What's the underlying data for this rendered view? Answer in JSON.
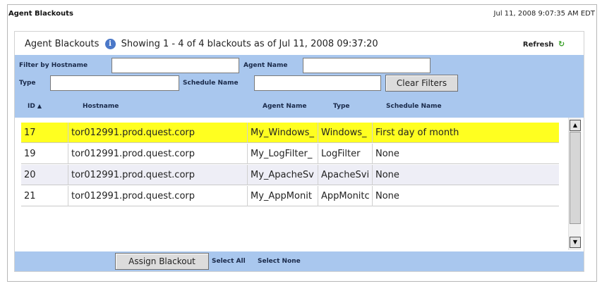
{
  "page": {
    "title": "Agent Blackouts",
    "timestamp": "Jul 11, 2008 9:07:35 AM EDT"
  },
  "panel": {
    "title": "Agent Blackouts",
    "info_icon": "info-icon",
    "summary": "Showing 1 - 4  of 4 blackouts as of Jul 11, 2008 09:37:20",
    "refresh_label": "Refresh",
    "refresh_icon": "refresh-icon"
  },
  "filters": {
    "hostname_label": "Filter by Hostname",
    "hostname_value": "",
    "agent_name_label": "Agent Name",
    "agent_name_value": "",
    "type_label": "Type",
    "type_value": "",
    "schedule_name_label": "Schedule Name",
    "schedule_name_value": "",
    "clear_button": "Clear Filters"
  },
  "table": {
    "columns": [
      "ID",
      "Hostname",
      "Agent Name",
      "Type",
      "Schedule Name"
    ],
    "sort_icon": "sort-ascending-icon",
    "rows": [
      {
        "id": "17",
        "hostname": "tor012991.prod.quest.corp",
        "agent_name": "My_Windows_",
        "type": "Windows_",
        "schedule": "First day of month",
        "selected": true
      },
      {
        "id": "19",
        "hostname": "tor012991.prod.quest.corp",
        "agent_name": "My_LogFilter_",
        "type": "LogFilter",
        "schedule": "None",
        "selected": false
      },
      {
        "id": "20",
        "hostname": "tor012991.prod.quest.corp",
        "agent_name": "My_ApacheSv",
        "type": "ApacheSvi",
        "schedule": "None",
        "selected": false
      },
      {
        "id": "21",
        "hostname": "tor012991.prod.quest.corp",
        "agent_name": "My_AppMonit",
        "type": "AppMonitc",
        "schedule": "None",
        "selected": false
      }
    ]
  },
  "footer": {
    "assign_button": "Assign Blackout",
    "select_all": "Select All",
    "select_none": "Select None"
  },
  "colors": {
    "header_blue": "#a9c7ee",
    "selected_row": "#ffff20",
    "alt_row": "#eeeef6"
  }
}
